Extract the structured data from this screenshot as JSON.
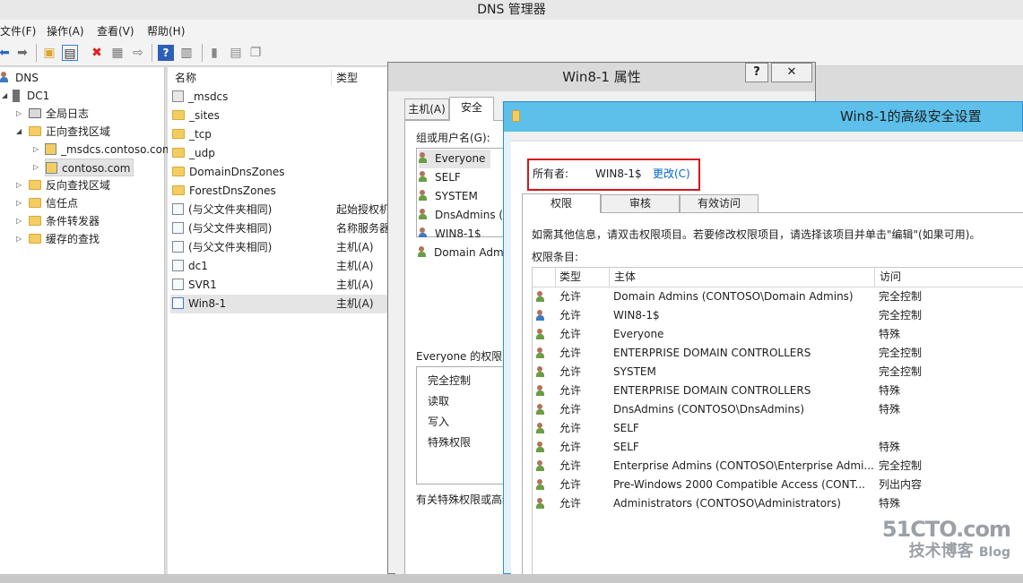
{
  "app": {
    "title": "DNS 管理器"
  },
  "menu": [
    "文件(F)",
    "操作(A)",
    "查看(V)",
    "帮助(H)"
  ],
  "tree": {
    "root": "DNS",
    "server": "DC1",
    "items": [
      "全局日志",
      "正向查找区域",
      "_msdcs.contoso.com",
      "contoso.com",
      "反向查找区域",
      "信任点",
      "条件转发器",
      "缓存的查找"
    ]
  },
  "list": {
    "columns": [
      "名称",
      "类型"
    ],
    "rows": [
      {
        "name": "_msdcs",
        "type": ""
      },
      {
        "name": "_sites",
        "type": ""
      },
      {
        "name": "_tcp",
        "type": ""
      },
      {
        "name": "_udp",
        "type": ""
      },
      {
        "name": "DomainDnsZones",
        "type": ""
      },
      {
        "name": "ForestDnsZones",
        "type": ""
      },
      {
        "name": "(与父文件夹相同)",
        "type": "起始授权机"
      },
      {
        "name": "(与父文件夹相同)",
        "type": "名称服务器"
      },
      {
        "name": "(与父文件夹相同)",
        "type": "主机(A)"
      },
      {
        "name": "dc1",
        "type": "主机(A)"
      },
      {
        "name": "SVR1",
        "type": "主机(A)"
      },
      {
        "name": "Win8-1",
        "type": "主机(A)"
      }
    ]
  },
  "props_dialog": {
    "title": "Win8-1 属性",
    "help": "?",
    "close": "✕",
    "tabs": [
      "主机(A)",
      "安全"
    ],
    "group_label": "组或用户名(G):",
    "users": [
      "Everyone",
      "SELF",
      "SYSTEM",
      "DnsAdmins (",
      "WIN8-1$",
      "Domain Adm"
    ],
    "perm_label": "Everyone 的权限(",
    "perms": [
      "完全控制",
      "读取",
      "写入",
      "特殊权限"
    ],
    "special_note": "有关特殊权限或高级"
  },
  "adv_dialog": {
    "title": "Win8-1的高级安全设置",
    "owner_label": "所有者:",
    "owner_value": "WIN8-1$",
    "change_link": "更改(C)",
    "tabs": [
      "权限",
      "审核",
      "有效访问"
    ],
    "info": "如需其他信息，请双击权限项目。若要修改权限项目，请选择该项目并单击\"编辑\"(如果可用)。",
    "entries_label": "权限条目:",
    "columns": [
      "类型",
      "主体",
      "访问"
    ],
    "entries": [
      {
        "type": "允许",
        "principal": "Domain Admins (CONTOSO\\Domain Admins)",
        "access": "完全控制"
      },
      {
        "type": "允许",
        "principal": "WIN8-1$",
        "access": "完全控制"
      },
      {
        "type": "允许",
        "principal": "Everyone",
        "access": "特殊"
      },
      {
        "type": "允许",
        "principal": "ENTERPRISE DOMAIN CONTROLLERS",
        "access": "完全控制"
      },
      {
        "type": "允许",
        "principal": "SYSTEM",
        "access": "完全控制"
      },
      {
        "type": "允许",
        "principal": "ENTERPRISE DOMAIN CONTROLLERS",
        "access": "特殊"
      },
      {
        "type": "允许",
        "principal": "DnsAdmins (CONTOSO\\DnsAdmins)",
        "access": "特殊"
      },
      {
        "type": "允许",
        "principal": "SELF",
        "access": ""
      },
      {
        "type": "允许",
        "principal": "SELF",
        "access": "特殊"
      },
      {
        "type": "允许",
        "principal": "Enterprise Admins (CONTOSO\\Enterprise Admi...",
        "access": "完全控制"
      },
      {
        "type": "允许",
        "principal": "Pre-Windows 2000 Compatible Access (CONT...",
        "access": "列出内容"
      },
      {
        "type": "允许",
        "principal": "Administrators (CONTOSO\\Administrators)",
        "access": "特殊"
      }
    ]
  },
  "watermark": {
    "line1": "51CTO.com",
    "line2": "技术博客",
    "line3": "Blog"
  },
  "colors": {
    "highlight_box": "#d8141b",
    "adv_title_bar": "#5cc0ea",
    "link": "#0066cc"
  }
}
